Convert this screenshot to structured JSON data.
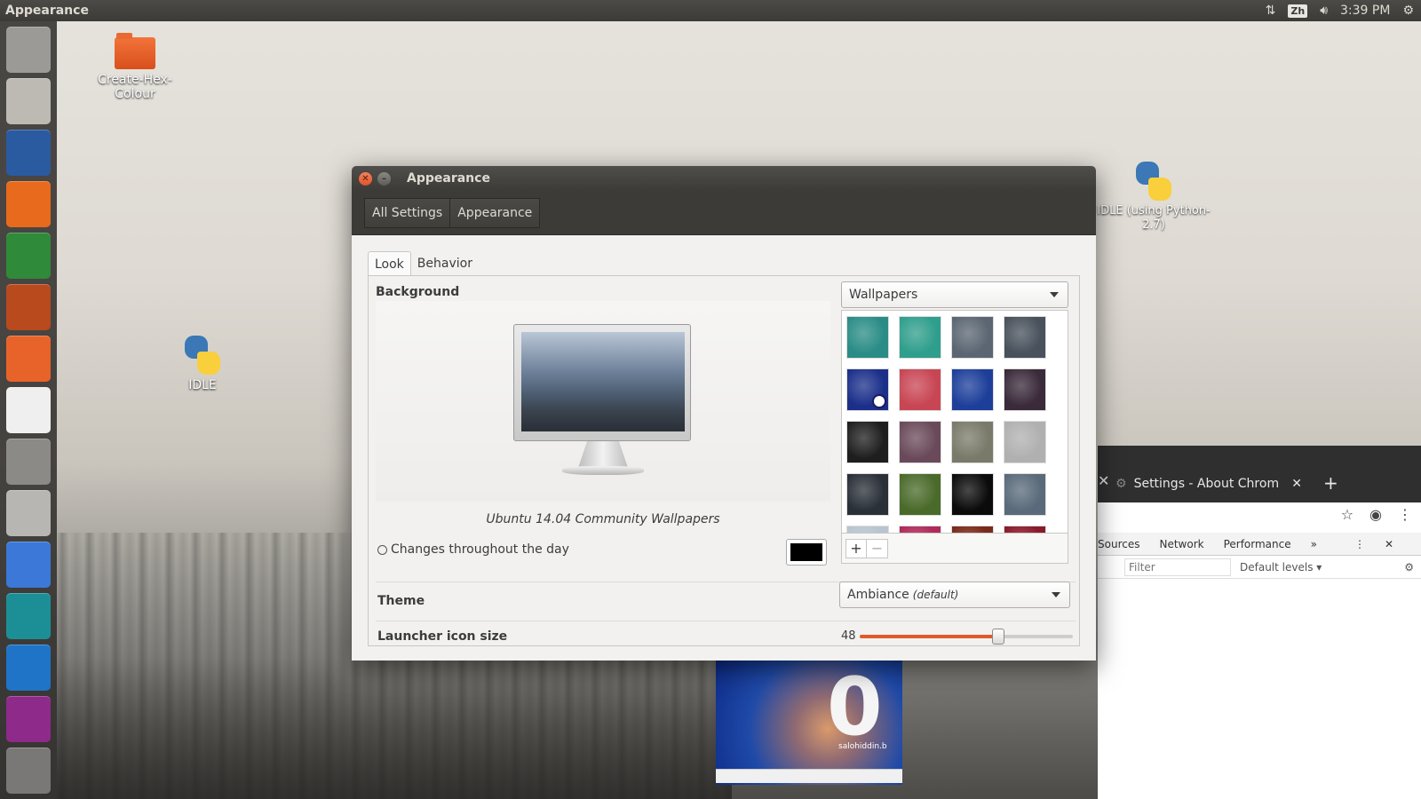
{
  "top_panel": {
    "app_title": "Appearance",
    "keyboard_indicator": "Zh",
    "time": "3:39 PM"
  },
  "launcher": {
    "items": [
      {
        "name": "ubuntu-dash",
        "color": "#9c9a96"
      },
      {
        "name": "files",
        "color": "#bdbab4"
      },
      {
        "name": "libreoffice-writer",
        "color": "#2a5aa0"
      },
      {
        "name": "firefox",
        "color": "#e86a1c"
      },
      {
        "name": "libreoffice-calc",
        "color": "#2f8a3a"
      },
      {
        "name": "libreoffice-impress",
        "color": "#b84a1e"
      },
      {
        "name": "ubuntu-software",
        "color": "#e8632a"
      },
      {
        "name": "amazon",
        "color": "#efefef"
      },
      {
        "name": "system-settings",
        "color": "#8b8a86"
      },
      {
        "name": "disks",
        "color": "#b8b6b2"
      },
      {
        "name": "chromium",
        "color": "#3b78d8"
      },
      {
        "name": "arduino",
        "color": "#1c8f96"
      },
      {
        "name": "vscode",
        "color": "#1f74c8"
      },
      {
        "name": "remote-desktop",
        "color": "#8e2a8a"
      },
      {
        "name": "trash",
        "color": "#7a7876"
      }
    ]
  },
  "desktop": {
    "icons": [
      {
        "label": "Create-Hex-Colour",
        "type": "folder"
      },
      {
        "label": "IDLE",
        "type": "python"
      },
      {
        "label": "IDLE (using Python-2.7)",
        "type": "python"
      }
    ]
  },
  "chrome": {
    "tab_title": "Settings - About Chrom",
    "devtools_tabs": [
      "Sources",
      "Network",
      "Performance",
      "»"
    ],
    "filter_placeholder": "Filter",
    "levels": "Default levels ▾"
  },
  "jelly_window": {
    "big_text": "0",
    "watermark": "salohiddin.b"
  },
  "appearance_window": {
    "title": "Appearance",
    "breadcrumbs": [
      "All Settings",
      "Appearance"
    ],
    "tabs": [
      "Look",
      "Behavior"
    ],
    "active_tab": "Look",
    "background_label": "Background",
    "wallpaper_source": "Wallpapers",
    "wallpaper_name": "Ubuntu 14.04 Community Wallpapers",
    "changes_label": "Changes throughout the day",
    "swatch_color": "#000000",
    "thumbnails": [
      {
        "color": "#2a8c86"
      },
      {
        "color": "#2f9e8c"
      },
      {
        "color": "#5b6672"
      },
      {
        "color": "#48515c"
      },
      {
        "color": "#1b2f8a",
        "marked": true
      },
      {
        "color": "#c84654"
      },
      {
        "color": "#1d3f9a"
      },
      {
        "color": "#3a2a3a"
      },
      {
        "color": "#1e1e1e"
      },
      {
        "color": "#6a4a5a"
      },
      {
        "color": "#7a7a6a"
      },
      {
        "color": "#b0b0b0"
      },
      {
        "color": "#2a3038"
      },
      {
        "color": "#4a6a2a"
      },
      {
        "color": "#0b0b0b"
      },
      {
        "color": "#5a6a7a"
      },
      {
        "color": "#b8c4d0"
      },
      {
        "color": "#b02a5a"
      },
      {
        "color": "#7a2a1a"
      },
      {
        "color": "#8a1a2a"
      }
    ],
    "add_button": "+",
    "remove_button": "−",
    "theme_label": "Theme",
    "theme_value": "Ambiance",
    "theme_default": "(default)",
    "launcher_size_label": "Launcher icon size",
    "launcher_size_value": "48",
    "launcher_size_fraction": 0.65
  }
}
